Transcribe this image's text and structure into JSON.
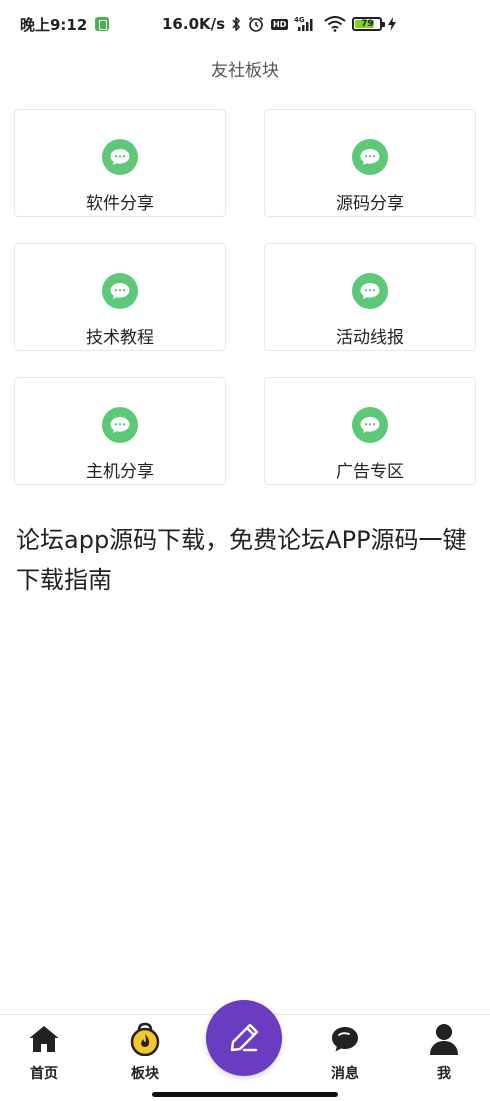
{
  "status_bar": {
    "time": "晚上9:12",
    "net_speed": "16.0K/s",
    "network": "4G",
    "hd_label": "HD",
    "battery_level": 79,
    "battery_text": "79",
    "icons": [
      "app-notification-icon",
      "bluetooth-icon",
      "alarm-icon",
      "hd-icon",
      "signal-icon",
      "wifi-icon",
      "battery-icon",
      "charging-icon"
    ]
  },
  "page": {
    "title": "友社板块"
  },
  "forums": [
    {
      "label": "软件分享",
      "icon": "chat-bubble-icon"
    },
    {
      "label": "源码分享",
      "icon": "chat-bubble-icon"
    },
    {
      "label": "技术教程",
      "icon": "chat-bubble-icon"
    },
    {
      "label": "活动线报",
      "icon": "chat-bubble-icon"
    },
    {
      "label": "主机分享",
      "icon": "chat-bubble-icon"
    },
    {
      "label": "广告专区",
      "icon": "chat-bubble-icon"
    }
  ],
  "article": {
    "title": "论坛app源码下载，免费论坛APP源码一键下载指南"
  },
  "bottom_nav": {
    "items": [
      {
        "label": "首页",
        "icon": "home-icon"
      },
      {
        "label": "板块",
        "icon": "board-icon"
      },
      {
        "label": "消息",
        "icon": "message-icon"
      },
      {
        "label": "我",
        "icon": "user-icon"
      }
    ],
    "compose_icon": "pen-icon"
  },
  "colors": {
    "accent_green": "#5cc878",
    "fab_purple": "#6a3cc0",
    "board_yellow": "#f2c62c"
  }
}
